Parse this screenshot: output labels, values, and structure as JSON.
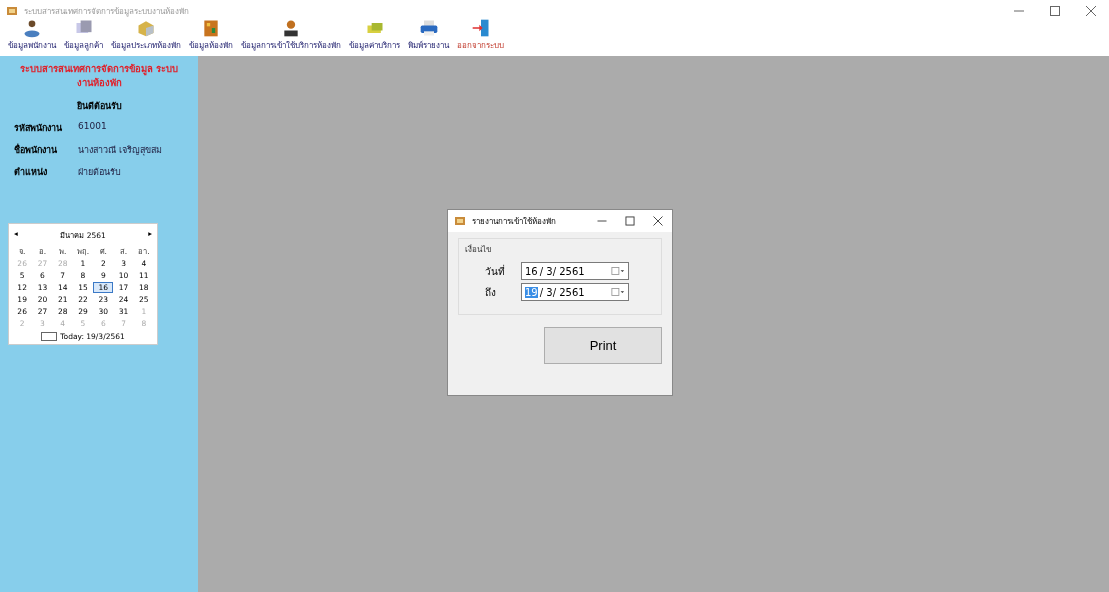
{
  "window": {
    "title": "ระบบสารสนเทศการจัดการข้อมูลระบบงานห้องพัก"
  },
  "toolbar": [
    {
      "label": "ข้อมูลพนักงาน",
      "danger": false
    },
    {
      "label": "ข้อมูลลูกค้า",
      "danger": false
    },
    {
      "label": "ข้อมูลประเภทห้องพัก",
      "danger": false
    },
    {
      "label": "ข้อมูลห้องพัก",
      "danger": false
    },
    {
      "label": "ข้อมูลการเข้าใช้บริการห้องพัก",
      "danger": false
    },
    {
      "label": "ข้อมูลค่าบริการ",
      "danger": false
    },
    {
      "label": "พิมพ์รายงาน",
      "danger": false
    },
    {
      "label": "ออกจากระบบ",
      "danger": true
    }
  ],
  "sidebar": {
    "title": "ระบบสารสนเทศการจัดการข้อมูล ระบบงานห้องพัก",
    "welcome": "ยินดีต้อนรับ",
    "fields": [
      {
        "label": "รหัสพนักงาน",
        "value": "61001"
      },
      {
        "label": "ชื่อพนักงาน",
        "value": "นางสาวณี เจริญสุขสม"
      },
      {
        "label": "ตำแหน่ง",
        "value": "ฝ่ายต้อนรับ"
      }
    ],
    "calendar": {
      "month": "มีนาคม 2561",
      "prev": "◂",
      "next": "▸",
      "weekdays": [
        "จ.",
        "อ.",
        "พ.",
        "พฤ.",
        "ศ.",
        "ส.",
        "อา."
      ],
      "weeks": [
        [
          {
            "d": "26",
            "other": true,
            "selected": false
          },
          {
            "d": "27",
            "other": true,
            "selected": false
          },
          {
            "d": "28",
            "other": true,
            "selected": false
          },
          {
            "d": "1",
            "other": false,
            "selected": false
          },
          {
            "d": "2",
            "other": false,
            "selected": false
          },
          {
            "d": "3",
            "other": false,
            "selected": false
          },
          {
            "d": "4",
            "other": false,
            "selected": false
          }
        ],
        [
          {
            "d": "5",
            "other": false,
            "selected": false
          },
          {
            "d": "6",
            "other": false,
            "selected": false
          },
          {
            "d": "7",
            "other": false,
            "selected": false
          },
          {
            "d": "8",
            "other": false,
            "selected": false
          },
          {
            "d": "9",
            "other": false,
            "selected": false
          },
          {
            "d": "10",
            "other": false,
            "selected": false
          },
          {
            "d": "11",
            "other": false,
            "selected": false
          }
        ],
        [
          {
            "d": "12",
            "other": false,
            "selected": false
          },
          {
            "d": "13",
            "other": false,
            "selected": false
          },
          {
            "d": "14",
            "other": false,
            "selected": false
          },
          {
            "d": "15",
            "other": false,
            "selected": false
          },
          {
            "d": "16",
            "other": false,
            "selected": true
          },
          {
            "d": "17",
            "other": false,
            "selected": false
          },
          {
            "d": "18",
            "other": false,
            "selected": false
          }
        ],
        [
          {
            "d": "19",
            "other": false,
            "selected": false
          },
          {
            "d": "20",
            "other": false,
            "selected": false
          },
          {
            "d": "21",
            "other": false,
            "selected": false
          },
          {
            "d": "22",
            "other": false,
            "selected": false
          },
          {
            "d": "23",
            "other": false,
            "selected": false
          },
          {
            "d": "24",
            "other": false,
            "selected": false
          },
          {
            "d": "25",
            "other": false,
            "selected": false
          }
        ],
        [
          {
            "d": "26",
            "other": false,
            "selected": false
          },
          {
            "d": "27",
            "other": false,
            "selected": false
          },
          {
            "d": "28",
            "other": false,
            "selected": false
          },
          {
            "d": "29",
            "other": false,
            "selected": false
          },
          {
            "d": "30",
            "other": false,
            "selected": false
          },
          {
            "d": "31",
            "other": false,
            "selected": false
          },
          {
            "d": "1",
            "other": true,
            "selected": false
          }
        ],
        [
          {
            "d": "2",
            "other": true,
            "selected": false
          },
          {
            "d": "3",
            "other": true,
            "selected": false
          },
          {
            "d": "4",
            "other": true,
            "selected": false
          },
          {
            "d": "5",
            "other": true,
            "selected": false
          },
          {
            "d": "6",
            "other": true,
            "selected": false
          },
          {
            "d": "7",
            "other": true,
            "selected": false
          },
          {
            "d": "8",
            "other": true,
            "selected": false
          }
        ]
      ],
      "today": "Today: 19/3/2561"
    }
  },
  "dialog": {
    "title": "รายงานการเข้าใช้ห้องพัก",
    "group": "เงื่อนไข",
    "fields": [
      {
        "label": "วันที่",
        "day": "16",
        "rest": "/ 3/ 2561",
        "focused": false
      },
      {
        "label": "ถึง",
        "day": "19",
        "rest": "/ 3/ 2561",
        "focused": true
      }
    ],
    "button": "Print"
  }
}
